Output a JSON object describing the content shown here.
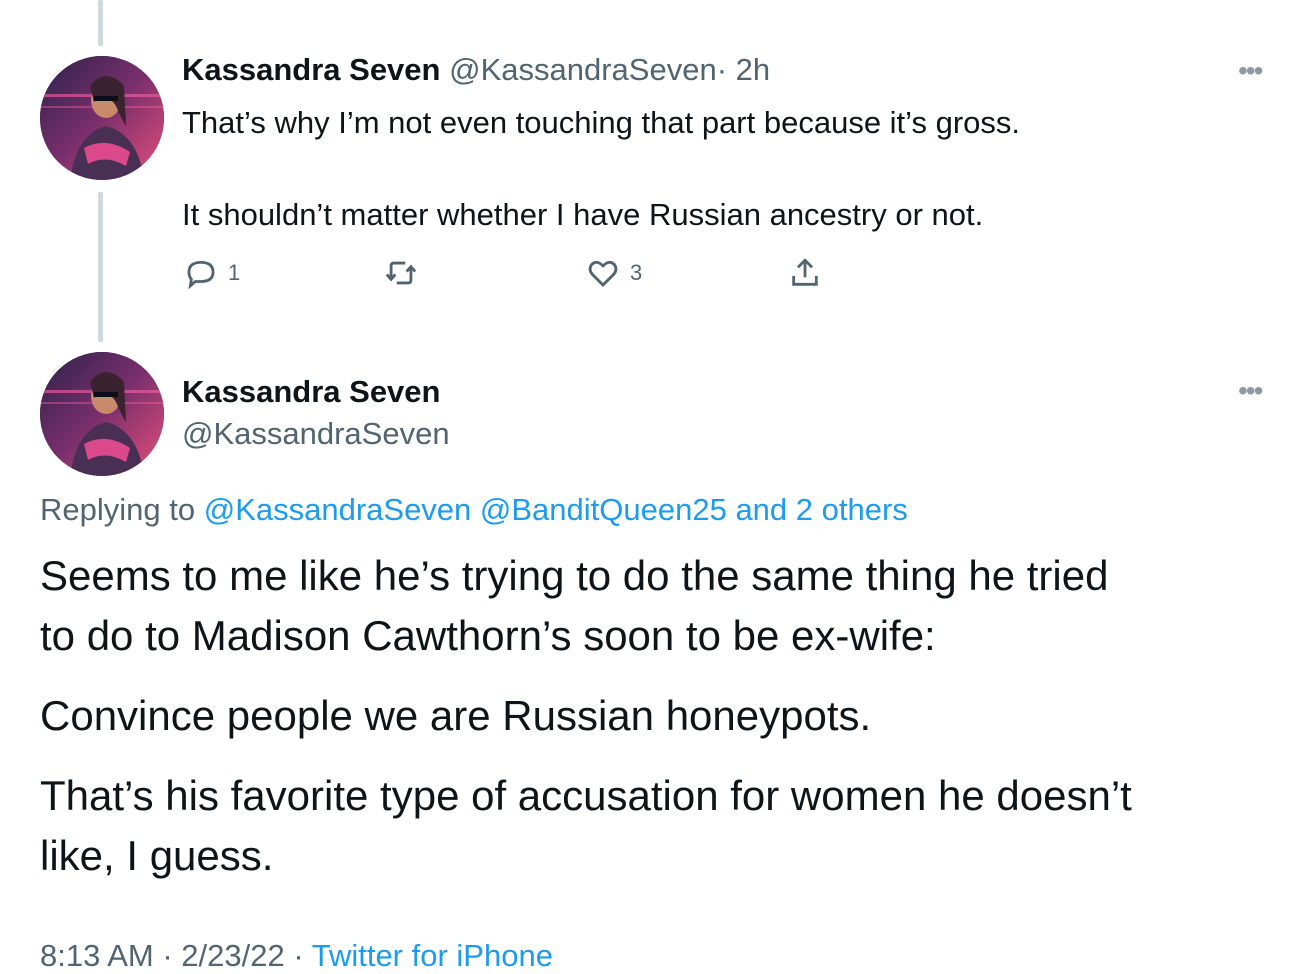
{
  "reply": {
    "display_name": "Kassandra Seven",
    "handle": "@KassandraSeven",
    "separator": "·",
    "time": "2h",
    "text_line_1": "That’s why I’m not even touching that part because it’s gross.",
    "text_line_2": "It shouldn’t matter whether I have Russian ancestry or not.",
    "reply_count": "1",
    "retweet_count": "",
    "like_count": "3",
    "more_icon": "more-horizontal-icon"
  },
  "main": {
    "display_name": "Kassandra Seven",
    "handle": "@KassandraSeven",
    "replying_to_label": "Replying to",
    "replying_to_users": "@KassandraSeven @BanditQueen25 and 2 others",
    "paragraph_1_line_1": "Seems to me like he’s trying to do the  same thing he tried",
    "paragraph_1_line_2": "to do to Madison Cawthorn’s soon to be ex-wife:",
    "paragraph_2": "Convince people we are Russian honeypots.",
    "paragraph_3_line_1": "That’s his favorite type of accusation for women he doesn’t",
    "paragraph_3_line_2": "like, I guess.",
    "timestamp": "8:13 AM · 2/23/22 ·",
    "source": "Twitter for iPhone"
  },
  "colors": {
    "text": "#0f1419",
    "muted": "#536471",
    "link": "#1d9bf0",
    "thread_line": "#cfd9de"
  }
}
